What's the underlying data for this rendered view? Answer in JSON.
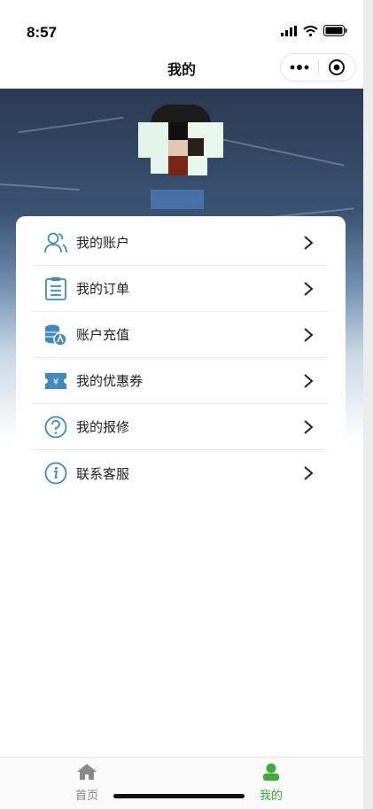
{
  "status_bar": {
    "time": "8:57"
  },
  "nav": {
    "title": "我的"
  },
  "menu": {
    "items": [
      {
        "label": "我的账户",
        "icon": "user-icon"
      },
      {
        "label": "我的订单",
        "icon": "order-list-icon"
      },
      {
        "label": "账户充值",
        "icon": "coins-recharge-icon"
      },
      {
        "label": "我的优惠券",
        "icon": "coupon-icon"
      },
      {
        "label": "我的报修",
        "icon": "question-icon"
      },
      {
        "label": "联系客服",
        "icon": "info-icon"
      }
    ]
  },
  "tab_bar": {
    "tabs": [
      {
        "label": "首页",
        "icon": "home-icon",
        "active": false
      },
      {
        "label": "我的",
        "icon": "person-icon",
        "active": true
      }
    ]
  },
  "colors": {
    "accent_blue": "#3f8bbd",
    "tab_active": "#3cad37",
    "tab_inactive": "#8a8a8a"
  }
}
